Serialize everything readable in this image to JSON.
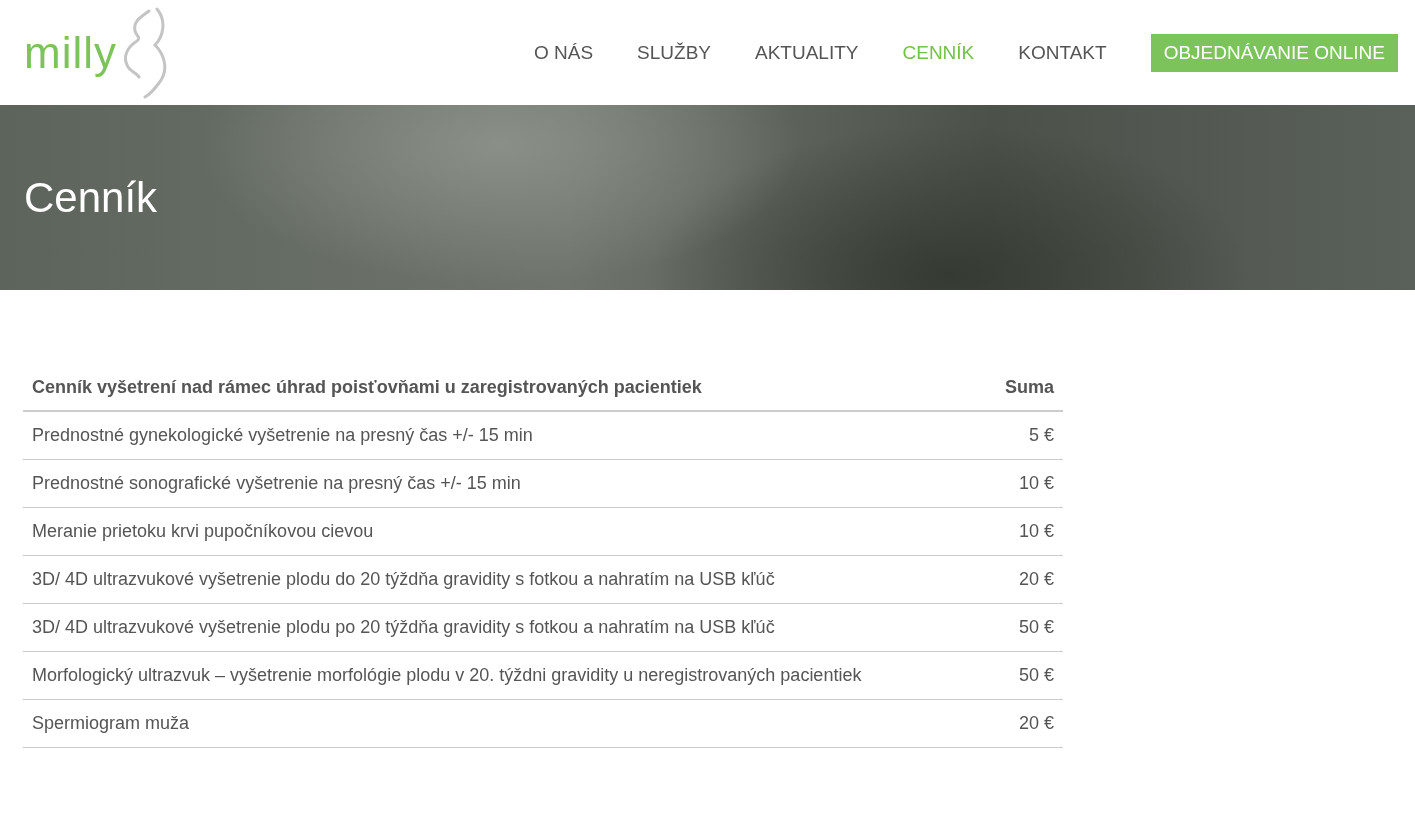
{
  "logo": {
    "text": "milly"
  },
  "nav": [
    {
      "label": "O NÁS",
      "selected": false
    },
    {
      "label": "SLUŽBY",
      "selected": false
    },
    {
      "label": "AKTUALITY",
      "selected": false
    },
    {
      "label": "CENNÍK",
      "selected": true
    },
    {
      "label": "KONTAKT",
      "selected": false
    }
  ],
  "cta_button": "OBJEDNÁVANIE ONLINE",
  "hero": {
    "title": "Cenník"
  },
  "table": {
    "columns": [
      "Cenník vyšetrení nad rámec úhrad poisťovňami u zaregistrovaných pacientiek",
      "Suma"
    ],
    "rows": [
      [
        "Prednostné gynekologické vyšetrenie na presný čas +/- 15 min",
        "5 €"
      ],
      [
        "Prednostné sonografické vyšetrenie na presný čas +/- 15 min",
        "10 €"
      ],
      [
        "Meranie prietoku krvi pupočníkovou cievou",
        "10 €"
      ],
      [
        "3D/ 4D ultrazvukové vyšetrenie plodu do 20 týždňa gravidity s fotkou a nahratím na USB kľúč",
        "20 €"
      ],
      [
        "3D/ 4D ultrazvukové vyšetrenie plodu po 20 týždňa gravidity s fotkou a nahratím na USB kľúč",
        "50 €"
      ],
      [
        "Morfologický ultrazvuk – vyšetrenie morfológie plodu v 20. týždni gravidity u neregistrovaných pacientiek",
        "50 €"
      ],
      [
        "Spermiogram muža",
        "20 €"
      ]
    ]
  }
}
